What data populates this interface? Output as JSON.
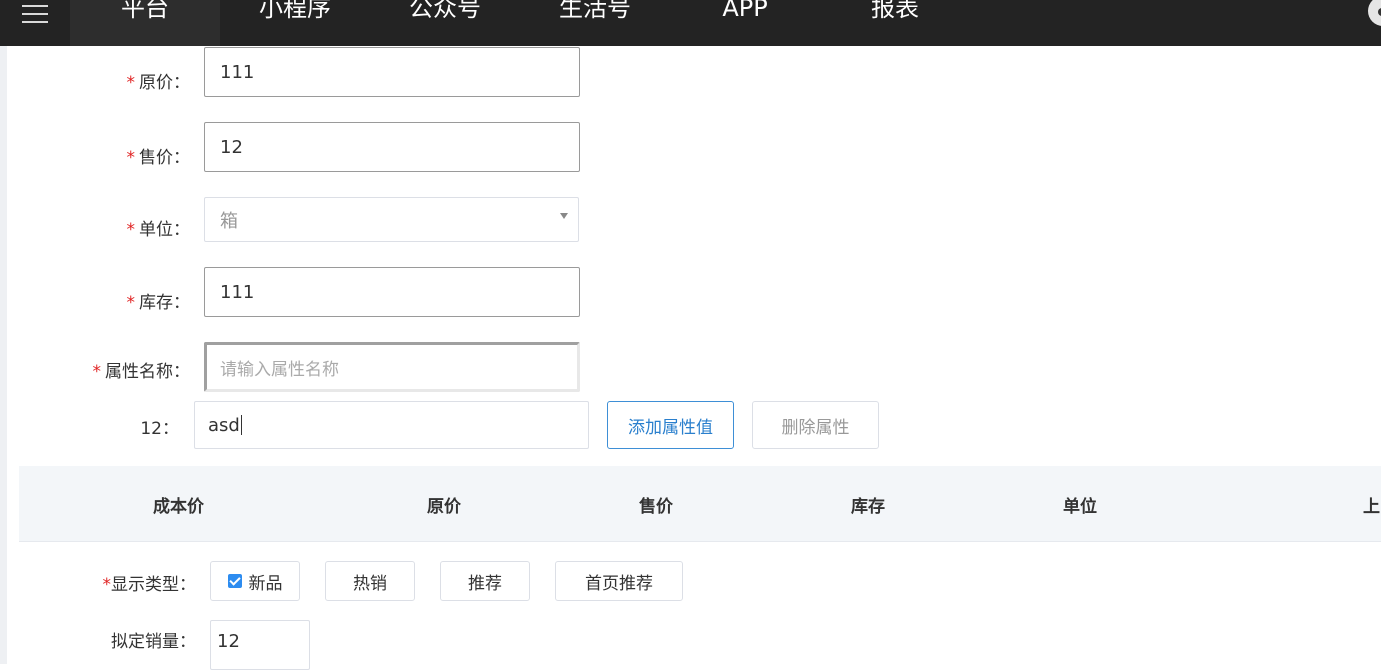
{
  "nav": {
    "tabs": [
      {
        "label": "平台",
        "active": true
      },
      {
        "label": "小程序",
        "active": false
      },
      {
        "label": "公众号",
        "active": false
      },
      {
        "label": "生活号",
        "active": false
      },
      {
        "label": "APP",
        "active": false
      },
      {
        "label": "报表",
        "active": false
      }
    ]
  },
  "form": {
    "original_price": {
      "label": "原价：",
      "required_mark": "*",
      "value": "111"
    },
    "sale_price": {
      "label": "售价：",
      "required_mark": "*",
      "value": "12"
    },
    "unit": {
      "label": "单位：",
      "required_mark": "*",
      "selected": "箱"
    },
    "stock": {
      "label": "库存：",
      "required_mark": "*",
      "value": "111"
    },
    "attr_name": {
      "label": "属性名称：",
      "required_mark": "*",
      "placeholder": "请输入属性名称"
    },
    "attr_value": {
      "label": "12：",
      "value": "asd"
    },
    "buttons": {
      "add_attr_value": "添加属性值",
      "delete_attr": "删除属性"
    }
  },
  "table": {
    "headers": [
      "成本价",
      "原价",
      "售价",
      "库存",
      "单位",
      "上"
    ]
  },
  "display_type": {
    "label": "显示类型：",
    "required_mark": "*",
    "options": [
      {
        "label": "新品",
        "checked": true
      },
      {
        "label": "热销",
        "checked": false
      },
      {
        "label": "推荐",
        "checked": false
      },
      {
        "label": "首页推荐",
        "checked": false
      }
    ]
  },
  "planned_sales": {
    "label": "拟定销量：",
    "value": "12"
  },
  "colors": {
    "accent": "#2a7fcd",
    "checkbox": "#2d8cf0",
    "required": "#e02424",
    "nav_bg": "#232323"
  }
}
